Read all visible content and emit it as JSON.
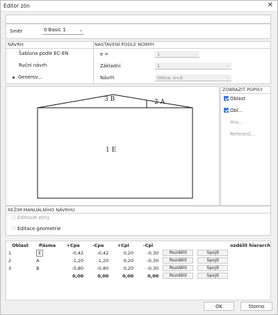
{
  "window": {
    "title": "Editor zón",
    "close_glyph": "✕"
  },
  "direction": {
    "label": "Směr",
    "value": "0 Basic 1"
  },
  "design": {
    "header": "NÁVRH",
    "options": [
      {
        "label": "Šablona podle EC-EN",
        "selected": false
      },
      {
        "label": "Ruční návrh",
        "selected": false
      },
      {
        "label": "Generov...",
        "selected": true
      }
    ]
  },
  "norm": {
    "header": "NASTAVENÍ PODLE NORMY",
    "fields": [
      {
        "label": "e =",
        "value": "1"
      },
      {
        "label": "Základní",
        "value": "1"
      },
      {
        "label": "Návrh",
        "value": "Stěna: e<d"
      }
    ]
  },
  "show_labels": {
    "header": "ZOBRAZIT POPISY",
    "items": [
      {
        "label": "Oblast",
        "checked": true,
        "enabled": true
      },
      {
        "label": "Obl...",
        "checked": true,
        "enabled": true
      },
      {
        "label": "Hra...",
        "checked": false,
        "enabled": false
      },
      {
        "label": "Referenč...",
        "checked": false,
        "enabled": false
      }
    ]
  },
  "drawing": {
    "zones": [
      "3 B",
      "2 A",
      "1 E"
    ]
  },
  "manual": {
    "header": "REŽIM MANUÁLNÍHO NÁVRHU",
    "items": [
      {
        "label": "Editovat zóny"
      },
      {
        "label": "Editace geometrie"
      }
    ]
  },
  "table": {
    "headers": [
      "Oblast",
      "Pásma",
      "+Cpe",
      "-Cpe",
      "+Cpi",
      "-Cpi",
      "",
      "",
      "ozdělit hierarch"
    ],
    "rows": [
      {
        "oblast": "1",
        "pasmo": "E",
        "cpe_plus": "-0,42",
        "cpe_minus": "-0,42",
        "cpi_plus": "0,20",
        "cpi_minus": "-0,30",
        "split": "Rozdělit",
        "merge": "Spojit"
      },
      {
        "oblast": "2",
        "pasmo": "A",
        "cpe_plus": "-1,20",
        "cpe_minus": "-1,20",
        "cpi_plus": "0,20",
        "cpi_minus": "-0,30",
        "split": "Rozdělit",
        "merge": "Spojit"
      },
      {
        "oblast": "3",
        "pasmo": "B",
        "cpe_plus": "-0,80",
        "cpe_minus": "-0,80",
        "cpi_plus": "0,20",
        "cpi_minus": "-0,30",
        "split": "Rozdělit",
        "merge": "Spojit"
      }
    ],
    "totals": {
      "cpe_plus": "0,00",
      "cpe_minus": "0,00",
      "cpi_plus": "0,00",
      "cpi_minus": "0,00",
      "split": "Rozdělit",
      "merge": "Spojit"
    }
  },
  "buttons": {
    "ok": "OK",
    "cancel": "Storno"
  }
}
